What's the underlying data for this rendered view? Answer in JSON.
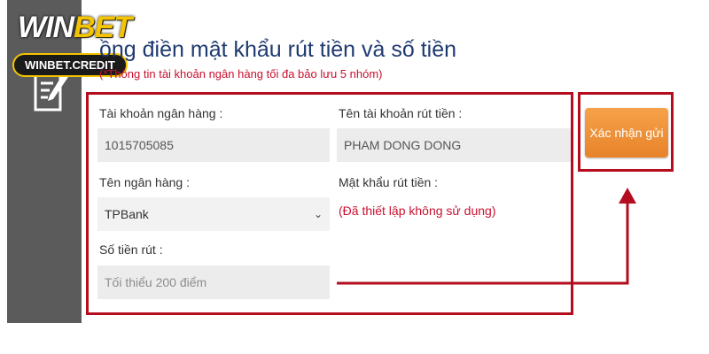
{
  "watermark": {
    "logo_win": "WIN",
    "logo_bet": "BET",
    "site": "WINBET.CREDIT"
  },
  "header": {
    "title": "ồng điền mật khẩu rút tiền và số tiền",
    "subtitle": "(*Thông tin tài khoản ngân hàng tối đa bảo lưu 5 nhóm)"
  },
  "form": {
    "bank_account_label": "Tài khoản ngân hàng :",
    "bank_account_value": "1015705085",
    "account_name_label": "Tên tài khoản rút tiền :",
    "account_name_value": "PHAM DONG DONG",
    "bank_name_label": "Tên ngân hàng :",
    "bank_name_value": "TPBank",
    "password_label": "Mật khẩu rút tiền :",
    "password_note": "(Đã thiết lập không sử dụng)",
    "amount_label": "Số tiền rút :",
    "amount_placeholder": "Tối thiểu 200 điểm"
  },
  "actions": {
    "submit_label": "Xác nhận gửi"
  },
  "colors": {
    "highlight_red": "#b40d1e",
    "button_orange": "#ec8a33",
    "title_blue": "#1f3a70",
    "sidebar_gray": "#5b5b5b"
  },
  "icons": {
    "sidebar": "document-edit-icon",
    "select": "chevron-down-icon"
  }
}
